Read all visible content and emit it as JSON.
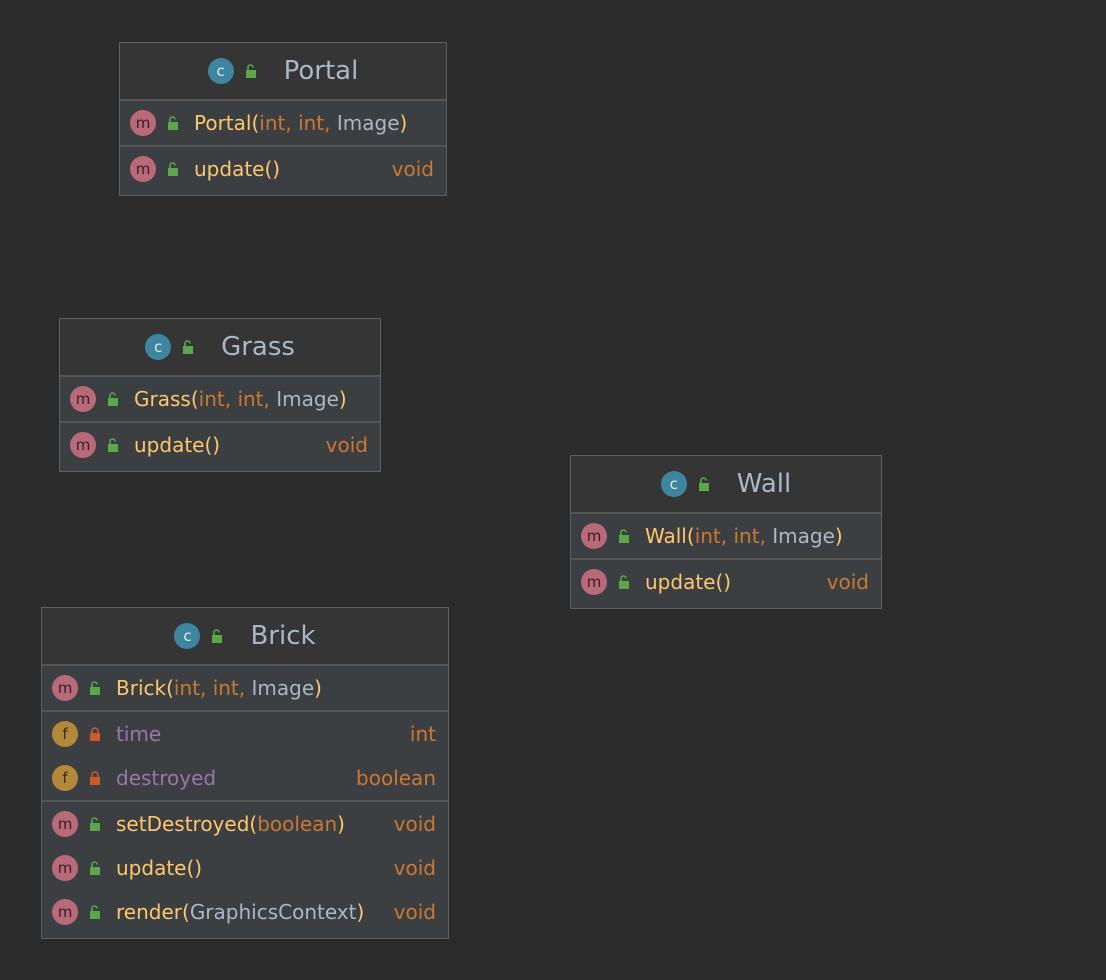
{
  "classes": {
    "portal": {
      "name": "Portal",
      "badge": "c",
      "constructor": {
        "badge": "m",
        "name": "Portal",
        "open": "(",
        "p1": "int",
        "c1": ",",
        "p2": "int",
        "c2": ",",
        "p3": "Image",
        "close": ")"
      },
      "methods": [
        {
          "badge": "m",
          "name": "update",
          "parens": "()",
          "ret": "void"
        }
      ]
    },
    "grass": {
      "name": "Grass",
      "badge": "c",
      "constructor": {
        "badge": "m",
        "name": "Grass",
        "open": "(",
        "p1": "int",
        "c1": ",",
        "p2": "int",
        "c2": ",",
        "p3": "Image",
        "close": ")"
      },
      "methods": [
        {
          "badge": "m",
          "name": "update",
          "parens": "()",
          "ret": "void"
        }
      ]
    },
    "wall": {
      "name": "Wall",
      "badge": "c",
      "constructor": {
        "badge": "m",
        "name": "Wall",
        "open": "(",
        "p1": "int",
        "c1": ",",
        "p2": "int",
        "c2": ",",
        "p3": "Image",
        "close": ")"
      },
      "methods": [
        {
          "badge": "m",
          "name": "update",
          "parens": "()",
          "ret": "void"
        }
      ]
    },
    "brick": {
      "name": "Brick",
      "badge": "c",
      "constructor": {
        "badge": "m",
        "name": "Brick",
        "open": "(",
        "p1": "int",
        "c1": ",",
        "p2": "int",
        "c2": ",",
        "p3": "Image",
        "close": ")"
      },
      "fields": [
        {
          "badge": "f",
          "name": "time",
          "type": "int"
        },
        {
          "badge": "f",
          "name": "destroyed",
          "type": "boolean"
        }
      ],
      "methods": [
        {
          "badge": "m",
          "name": "setDestroyed",
          "open": "(",
          "param": "boolean",
          "close": ")",
          "ret": "void"
        },
        {
          "badge": "m",
          "name": "update",
          "parens": "()",
          "ret": "void"
        },
        {
          "badge": "m",
          "name": "render",
          "open": "(",
          "param": "GraphicsContext",
          "close": ")",
          "ret": "void"
        }
      ]
    }
  },
  "icons": {
    "public": "unlocked-padlock-icon",
    "private": "locked-padlock-icon"
  },
  "colors": {
    "background": "#2b2b2b",
    "method_name": "#ffc66d",
    "field_name": "#9876aa",
    "keyword": "#cc7832",
    "class_name": "#a9b7c6",
    "public_lock": "#5aa84a",
    "private_lock": "#cc5a2a"
  }
}
